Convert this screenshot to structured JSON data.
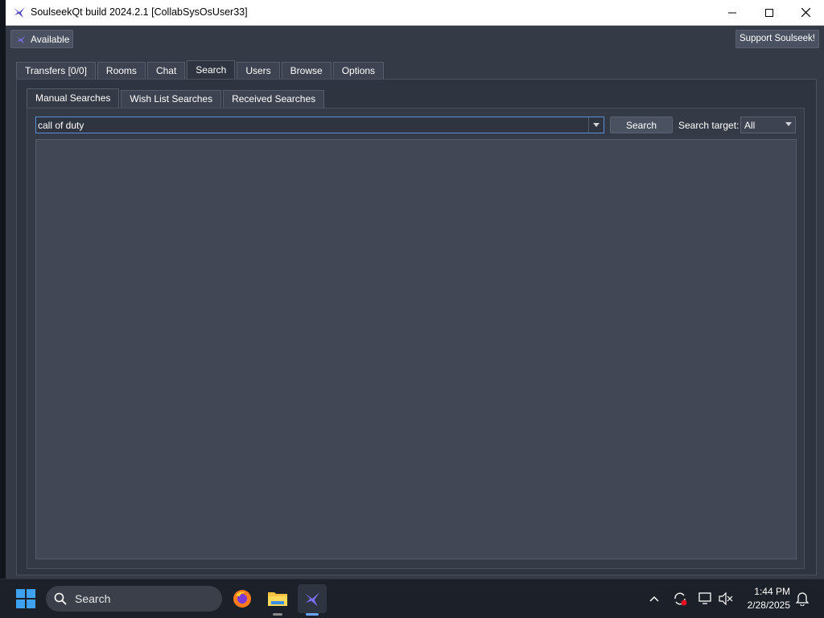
{
  "window": {
    "title": "SoulseekQt build 2024.2.1 [CollabSysOsUser33]",
    "controls": [
      "minimize-icon",
      "maximize-icon",
      "close-icon"
    ]
  },
  "toolbar": {
    "status_label": "Available",
    "support_label": "Support Soulseek!"
  },
  "main_tabs": [
    {
      "label": "Transfers [0/0]"
    },
    {
      "label": "Rooms"
    },
    {
      "label": "Chat"
    },
    {
      "label": "Search",
      "active": true
    },
    {
      "label": "Users"
    },
    {
      "label": "Browse"
    },
    {
      "label": "Options"
    }
  ],
  "sub_tabs": [
    {
      "label": "Manual Searches",
      "active": true
    },
    {
      "label": "Wish List Searches"
    },
    {
      "label": "Received Searches"
    }
  ],
  "search": {
    "query": "call of duty",
    "button_label": "Search",
    "target_label": "Search target:",
    "target_value": "All"
  },
  "taskbar": {
    "search_label": "Search",
    "time": "1:44 PM",
    "date": "2/28/2025",
    "apps": [
      "firefox-icon",
      "file-explorer-icon",
      "soulseek-icon"
    ]
  },
  "colors": {
    "window_bg": "#353b46",
    "focus_border": "#5b8fd6",
    "taskbar_bg": "#1c2029"
  }
}
